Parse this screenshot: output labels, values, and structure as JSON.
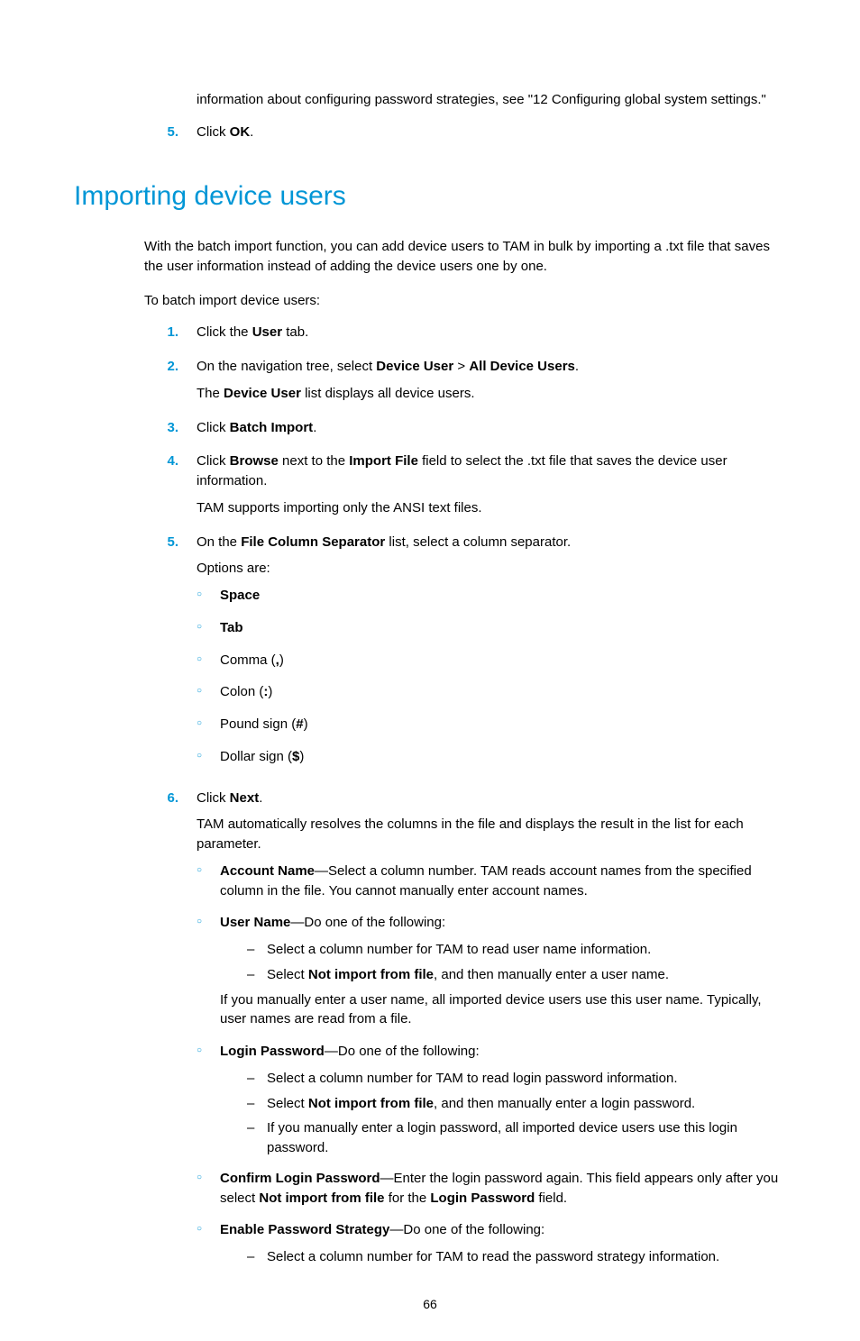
{
  "continuation_paragraph": "information about configuring password strategies, see \"12 Configuring global system settings.\"",
  "top_steps": [
    {
      "num": "5.",
      "parts": [
        [
          "",
          "Click "
        ],
        [
          "b",
          "OK"
        ],
        [
          "",
          "."
        ]
      ]
    }
  ],
  "section_title": "Importing device users",
  "intro": "With the batch import function, you can add device users to TAM in bulk by importing a .txt file that saves the user information instead of adding the device users one by one.",
  "subintro": "To batch import device users:",
  "steps": [
    {
      "num": "1.",
      "paragraphs": [
        [
          [
            "",
            "Click the "
          ],
          [
            "b",
            "User"
          ],
          [
            "",
            " tab."
          ]
        ]
      ]
    },
    {
      "num": "2.",
      "paragraphs": [
        [
          [
            "",
            "On the navigation tree, select "
          ],
          [
            "b",
            "Device User"
          ],
          [
            "",
            " > "
          ],
          [
            "b",
            "All Device Users"
          ],
          [
            "",
            "."
          ]
        ],
        [
          [
            "",
            "The "
          ],
          [
            "b",
            "Device User"
          ],
          [
            "",
            " list displays all device users."
          ]
        ]
      ]
    },
    {
      "num": "3.",
      "paragraphs": [
        [
          [
            "",
            "Click "
          ],
          [
            "b",
            "Batch Import"
          ],
          [
            "",
            "."
          ]
        ]
      ]
    },
    {
      "num": "4.",
      "paragraphs": [
        [
          [
            "",
            "Click "
          ],
          [
            "b",
            "Browse"
          ],
          [
            "",
            " next to the "
          ],
          [
            "b",
            "Import File"
          ],
          [
            "",
            " field to select the .txt file that saves the device user information."
          ]
        ],
        [
          [
            "",
            "TAM supports importing only the ANSI text files."
          ]
        ]
      ]
    },
    {
      "num": "5.",
      "paragraphs": [
        [
          [
            "",
            "On the "
          ],
          [
            "b",
            "File Column Separator"
          ],
          [
            "",
            " list, select a column separator."
          ]
        ],
        [
          [
            "",
            "Options are:"
          ]
        ]
      ],
      "circ_list": [
        [
          [
            "b",
            "Space"
          ]
        ],
        [
          [
            "b",
            "Tab"
          ]
        ],
        [
          [
            "",
            "Comma ("
          ],
          [
            "b",
            ","
          ],
          [
            "",
            ")"
          ]
        ],
        [
          [
            "",
            "Colon ("
          ],
          [
            "b",
            ":"
          ],
          [
            "",
            ")"
          ]
        ],
        [
          [
            "",
            "Pound sign ("
          ],
          [
            "b",
            "#"
          ],
          [
            "",
            ")"
          ]
        ],
        [
          [
            "",
            "Dollar sign ("
          ],
          [
            "b",
            "$"
          ],
          [
            "",
            ")"
          ]
        ]
      ]
    },
    {
      "num": "6.",
      "paragraphs": [
        [
          [
            "",
            "Click "
          ],
          [
            "b",
            "Next"
          ],
          [
            "",
            "."
          ]
        ],
        [
          [
            "",
            "TAM automatically resolves the columns in the file and displays the result in the list for each parameter."
          ]
        ]
      ],
      "circ_items": [
        {
          "head": [
            [
              "b",
              "Account Name"
            ],
            [
              "",
              "—Select a column number. TAM reads account names from the specified column in the file. You cannot manually enter account names."
            ]
          ]
        },
        {
          "head": [
            [
              "b",
              "User Name"
            ],
            [
              "",
              "—Do one of the following:"
            ]
          ],
          "dashes": [
            [
              [
                "",
                "Select a column number for TAM to read user name information."
              ]
            ],
            [
              [
                "",
                "Select "
              ],
              [
                "b",
                "Not import from file"
              ],
              [
                "",
                ", and then manually enter a user name."
              ]
            ]
          ],
          "trailing": [
            [
              "",
              "If you manually enter a user name, all imported device users use this user name. Typically, user names are read from a file."
            ]
          ]
        },
        {
          "head": [
            [
              "b",
              "Login Password"
            ],
            [
              "",
              "—Do one of the following:"
            ]
          ],
          "dashes": [
            [
              [
                "",
                "Select a column number for TAM to read login password information."
              ]
            ],
            [
              [
                "",
                "Select "
              ],
              [
                "b",
                "Not import from file"
              ],
              [
                "",
                ", and then manually enter a login password."
              ]
            ],
            [
              [
                "",
                "If you manually enter a login password, all imported device users use this login password."
              ]
            ]
          ]
        },
        {
          "head": [
            [
              "b",
              "Confirm Login Password"
            ],
            [
              "",
              "—Enter the login password again. This field appears only after you select "
            ],
            [
              "b",
              "Not import from file"
            ],
            [
              "",
              " for the "
            ],
            [
              "b",
              "Login Password"
            ],
            [
              "",
              " field."
            ]
          ]
        },
        {
          "head": [
            [
              "b",
              "Enable Password Strategy"
            ],
            [
              "",
              "—Do one of the following:"
            ]
          ],
          "dashes": [
            [
              [
                "",
                "Select a column number for TAM to read the password strategy information."
              ]
            ]
          ]
        }
      ]
    }
  ],
  "page_number": "66"
}
